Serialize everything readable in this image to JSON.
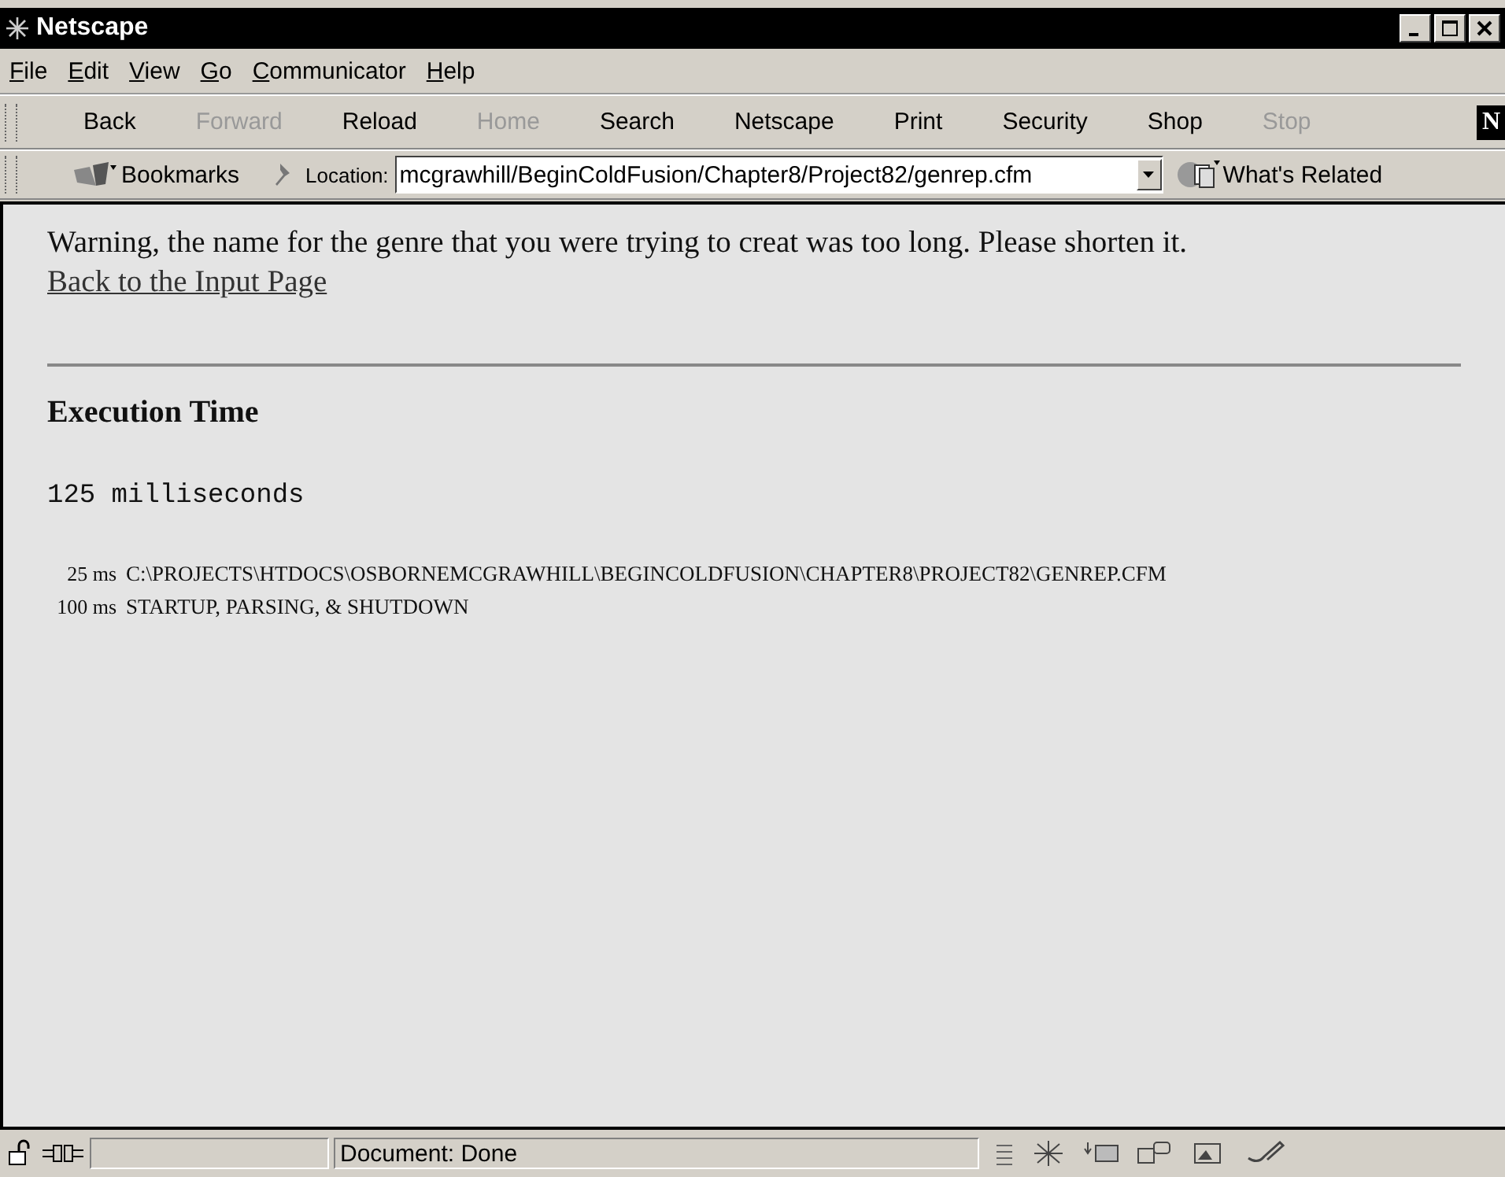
{
  "window": {
    "title": "Netscape"
  },
  "menu": [
    "File",
    "Edit",
    "View",
    "Go",
    "Communicator",
    "Help"
  ],
  "toolbar": [
    {
      "label": "Back",
      "disabled": false
    },
    {
      "label": "Forward",
      "disabled": true
    },
    {
      "label": "Reload",
      "disabled": false
    },
    {
      "label": "Home",
      "disabled": true
    },
    {
      "label": "Search",
      "disabled": false
    },
    {
      "label": "Netscape",
      "disabled": false
    },
    {
      "label": "Print",
      "disabled": false
    },
    {
      "label": "Security",
      "disabled": false
    },
    {
      "label": "Shop",
      "disabled": false
    },
    {
      "label": "Stop",
      "disabled": true
    }
  ],
  "logo": "N",
  "location_bar": {
    "bookmarks": "Bookmarks",
    "location_label": "Location:",
    "url": "mcgrawhill/BeginColdFusion/Chapter8/Project82/genrep.cfm",
    "whats_related": "What's Related"
  },
  "content": {
    "warning": "Warning, the name for the genre that you were trying to creat was too long. Please shorten it.",
    "link": "Back to the Input Page",
    "heading": "Execution Time",
    "total": "125 milliseconds",
    "timings": [
      {
        "time": "25 ms",
        "item": "C:\\PROJECTS\\HTDOCS\\OSBORNEMCGRAWHILL\\BEGINCOLDFUSION\\CHAPTER8\\PROJECT82\\GENREP.CFM"
      },
      {
        "time": "100 ms",
        "item": "STARTUP, PARSING, & SHUTDOWN"
      }
    ]
  },
  "status_bar": {
    "text": "Document: Done"
  }
}
